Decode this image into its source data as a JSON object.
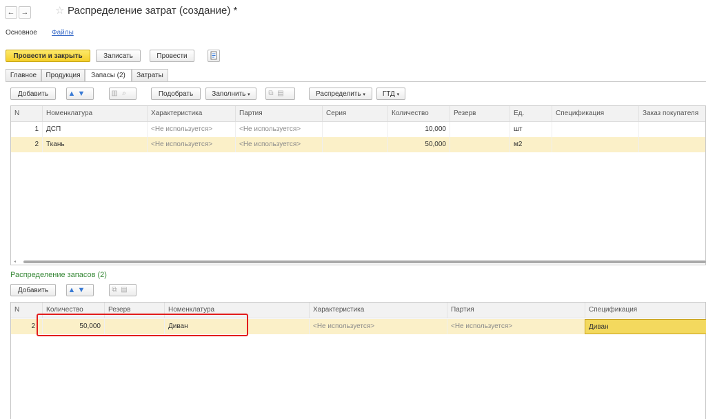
{
  "window": {
    "title": "Распределение затрат (создание) *",
    "nav_back_icon": "←",
    "nav_forward_icon": "→",
    "favorite_icon": "☆"
  },
  "sections": {
    "main": "Основное",
    "files": "Файлы"
  },
  "toolbar": {
    "post_close": "Провести и закрыть",
    "save": "Записать",
    "post": "Провести"
  },
  "tabs": [
    "Главное",
    "Продукция",
    "Запасы (2)",
    "Затраты"
  ],
  "stock_toolbar": {
    "add": "Добавить",
    "pick": "Подобрать",
    "fill": "Заполнить",
    "distribute": "Распределить",
    "gtd": "ГТД"
  },
  "stock_table": {
    "columns": [
      "N",
      "Номенклатура",
      "Характеристика",
      "Партия",
      "Серия",
      "Количество",
      "Резерв",
      "Ед.",
      "Спецификация",
      "Заказ покупателя"
    ],
    "rows": [
      {
        "n": "1",
        "nomenclature": "ДСП",
        "characteristic": "<Не используется>",
        "batch": "<Не используется>",
        "series": "",
        "quantity": "10,000",
        "reserve": "",
        "unit": "шт",
        "spec": "",
        "order": ""
      },
      {
        "n": "2",
        "nomenclature": "Ткань",
        "characteristic": "<Не используется>",
        "batch": "<Не используется>",
        "series": "",
        "quantity": "50,000",
        "reserve": "",
        "unit": "м2",
        "spec": "",
        "order": ""
      }
    ]
  },
  "distribution": {
    "label": "Распределение запасов (2)",
    "add": "Добавить",
    "columns": [
      "N",
      "Количество",
      "Резерв",
      "Номенклатура",
      "Характеристика",
      "Партия",
      "Спецификация"
    ],
    "rows": [
      {
        "n": "2",
        "quantity": "50,000",
        "reserve": "",
        "nomenclature": "Диван",
        "characteristic": "<Не используется>",
        "batch": "<Не используется>",
        "spec": "Диван"
      }
    ]
  },
  "colors": {
    "primary_button": "#f5cf2b",
    "selected_row": "#fbf0c8",
    "highlight_box": "#e21c1c",
    "section_label": "#3a8a3a",
    "link": "#3a6cc8"
  }
}
